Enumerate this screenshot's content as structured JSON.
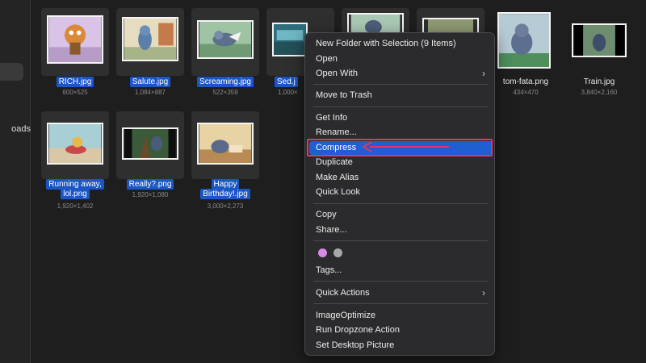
{
  "sidebar": {
    "item_label": "oads"
  },
  "files": [
    {
      "name": "RICH.jpg",
      "dims": "600×525",
      "selected": true
    },
    {
      "name": "Salute.jpg",
      "dims": "1,084×887",
      "selected": true
    },
    {
      "name": "Screaming.jpg",
      "dims": "522×359",
      "selected": true
    },
    {
      "name": "Sed.j",
      "dims": "1,000×",
      "selected": true
    },
    {
      "name": "tom-fata.png",
      "dims": "434×470",
      "selected": false
    },
    {
      "name": "Train.jpg",
      "dims": "3,840×2,160",
      "selected": false
    },
    {
      "name": "Running away,",
      "name2": "lol.png",
      "dims": "1,920×1,402",
      "selected": true
    },
    {
      "name": "Really?.png",
      "dims": "1,920×1,080",
      "selected": true
    },
    {
      "name": "Happy",
      "name2": "Birthday!.jpg",
      "dims": "3,000×2,273",
      "selected": true
    }
  ],
  "menu": {
    "new_folder": "New Folder with Selection (9 Items)",
    "open": "Open",
    "open_with": "Open With",
    "move_to_trash": "Move to Trash",
    "get_info": "Get Info",
    "rename": "Rename...",
    "compress": "Compress",
    "duplicate": "Duplicate",
    "make_alias": "Make Alias",
    "quick_look": "Quick Look",
    "copy": "Copy",
    "share": "Share...",
    "tags": "Tags...",
    "quick_actions": "Quick Actions",
    "image_optimize": "ImageOptimize",
    "run_dropzone": "Run Dropzone Action",
    "set_desktop": "Set Desktop Picture",
    "submenu_chevron": "›"
  },
  "tag_colors": [
    "#d98ae6",
    "#a8a8aa"
  ],
  "colors": {
    "selection": "#1b57c4",
    "menu_highlight": "#1f5fd1",
    "annotation": "#e0365f"
  }
}
